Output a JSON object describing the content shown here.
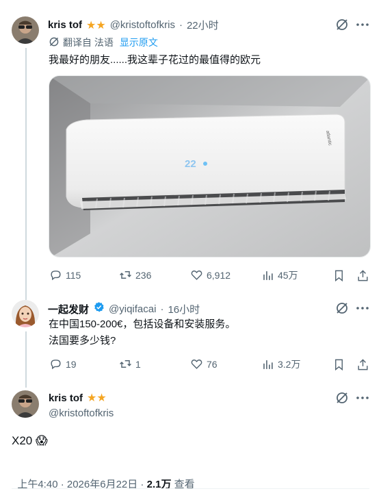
{
  "tweet1": {
    "name": "kris tof",
    "stars": "★★",
    "handle": "@kristoftofkris",
    "sep": "·",
    "time": "22小时",
    "translated_from": "翻译自 法语",
    "show_original": "显示原文",
    "text": "我最好的朋友......我这辈子花过的最值得的欧元",
    "ac_display": "22",
    "brand": "atlantic",
    "stats": {
      "replies": "115",
      "retweets": "236",
      "likes": "6,912",
      "views": "45万"
    }
  },
  "tweet2": {
    "name": "一起发财",
    "handle": "@yiqifacai",
    "sep": "·",
    "time": "16小时",
    "text_line1": "在中国150-200€，包括设备和安装服务。",
    "text_line2": "法国要多少钱?",
    "stats": {
      "replies": "19",
      "retweets": "1",
      "likes": "76",
      "views": "3.2万"
    }
  },
  "tweet3": {
    "name": "kris tof",
    "stars": "★★",
    "handle": "@kristoftofkris",
    "text": "X20 😱",
    "time": "上午4:40 · 2026年6月22日 · ",
    "views_count": "2.1万",
    "views_label": " 查看"
  },
  "colors": {
    "accent": "#1d9bf0",
    "muted": "#536471",
    "verified": "#1d9bf0",
    "star": "#f5a623"
  }
}
